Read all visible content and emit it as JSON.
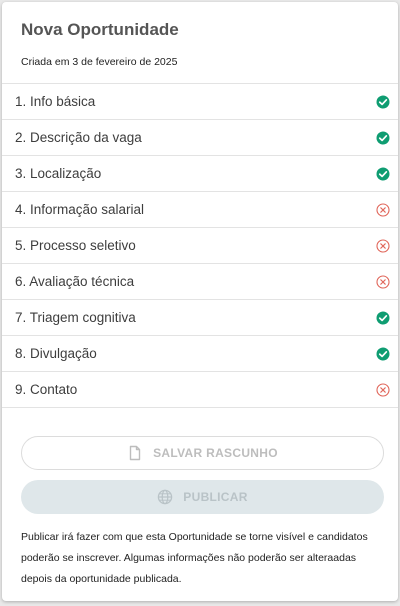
{
  "header": {
    "title": "Nova Oportunidade",
    "created": "Criada em 3 de fevereiro de 2025"
  },
  "steps": [
    {
      "label": "1. Info básica",
      "status": "complete",
      "icon": "check-circle-icon"
    },
    {
      "label": "2. Descrição da vaga",
      "status": "complete",
      "icon": "check-circle-icon"
    },
    {
      "label": "3. Localização",
      "status": "complete",
      "icon": "check-circle-icon"
    },
    {
      "label": "4. Informação salarial",
      "status": "incomplete",
      "icon": "x-circle-icon"
    },
    {
      "label": "5. Processo seletivo",
      "status": "incomplete",
      "icon": "x-circle-icon"
    },
    {
      "label": "6. Avaliação técnica",
      "status": "incomplete",
      "icon": "x-circle-icon"
    },
    {
      "label": "7. Triagem cognitiva",
      "status": "complete",
      "icon": "check-circle-icon"
    },
    {
      "label": "8. Divulgação",
      "status": "complete",
      "icon": "check-circle-icon"
    },
    {
      "label": "9. Contato",
      "status": "incomplete",
      "icon": "x-circle-icon"
    }
  ],
  "actions": {
    "draft_label": "SALVAR RASCUNHO",
    "draft_icon": "file-icon",
    "publish_label": "PUBLICAR",
    "publish_icon": "globe-icon"
  },
  "note": "Publicar irá fazer com que esta Oportunidade se torne visível e candidatos poderão se inscrever. Algumas informações não poderão ser alteraadas depois da oportunidade publicada.",
  "colors": {
    "complete": "#0f9d72",
    "incomplete": "#e0665a",
    "publish_bg": "#dfe7ea",
    "disabled_text": "#bdbdbd"
  }
}
